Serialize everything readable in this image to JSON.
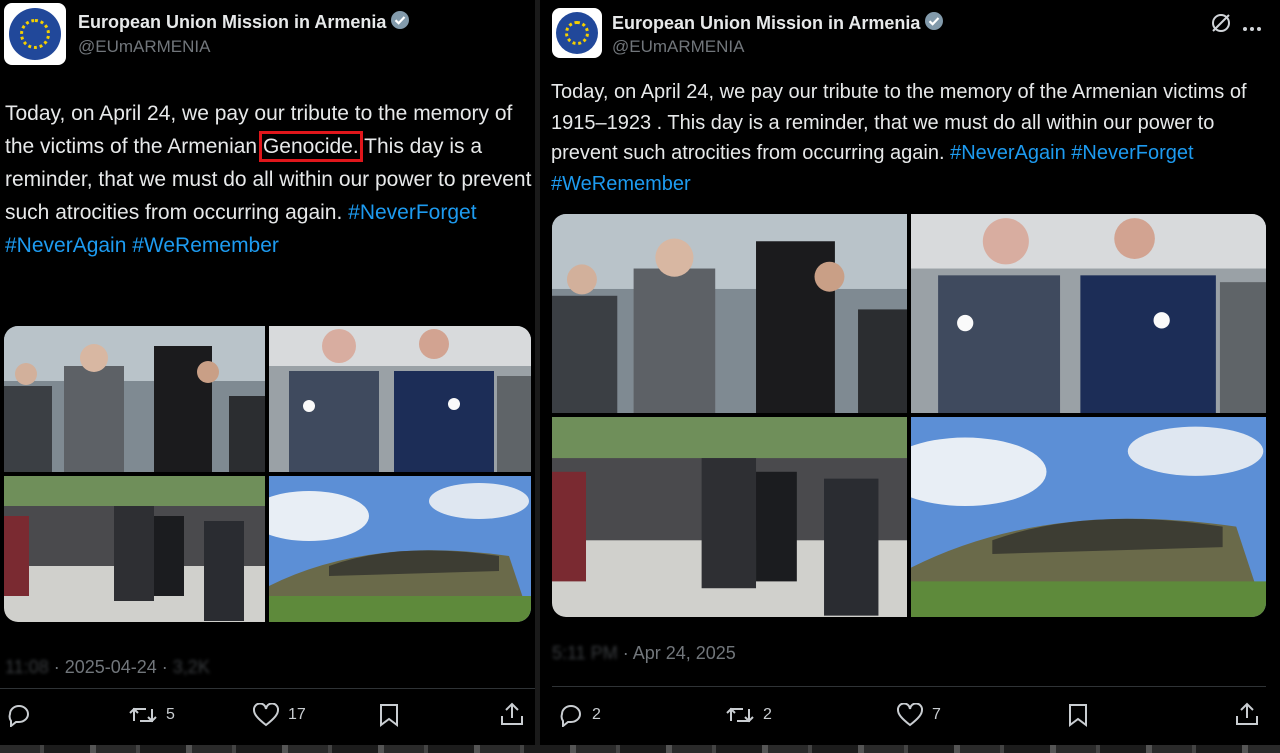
{
  "left": {
    "account_name": "European Union Mission in Armenia",
    "handle": "@EUmARMENIA",
    "text_before": "Today, on April 24, we pay our tribute to the memory of the victims of the Armenian ",
    "text_highlight": "Genocide.",
    "text_after": " This day is a reminder, that we must do all within our power to prevent such atrocities from occurring again. ",
    "hashtags": [
      "#NeverForget",
      "#NeverAgain",
      "#WeRemember"
    ],
    "time_blurred": "11:08",
    "date": "2025-04-24",
    "views_blurred": "3,2K",
    "reply_count": "",
    "retweet_count": "5",
    "like_count": "17"
  },
  "right": {
    "account_name": "European Union Mission in Armenia",
    "handle": "@EUmARMENIA",
    "text": "Today, on April 24, we pay our tribute to the memory of the Armenian victims of 1915–1923 . This day is a reminder, that we must do all within our power to prevent such atrocities from occurring again. ",
    "hashtags": [
      "#NeverAgain",
      "#NeverForget",
      "#WeRemember"
    ],
    "time_blurred": "5:11 PM",
    "date": "Apr 24, 2025",
    "reply_count": "2",
    "retweet_count": "2",
    "like_count": "7"
  },
  "icons": {
    "reply": "reply-icon",
    "retweet": "retweet-icon",
    "like": "heart-icon",
    "bookmark": "bookmark-icon",
    "share": "share-icon",
    "verified": "verified-badge-icon",
    "grok": "grok-icon",
    "more": "more-icon"
  },
  "colors": {
    "link": "#1d9bf0",
    "highlight_box": "#e0161b",
    "verified": "#829aab"
  }
}
